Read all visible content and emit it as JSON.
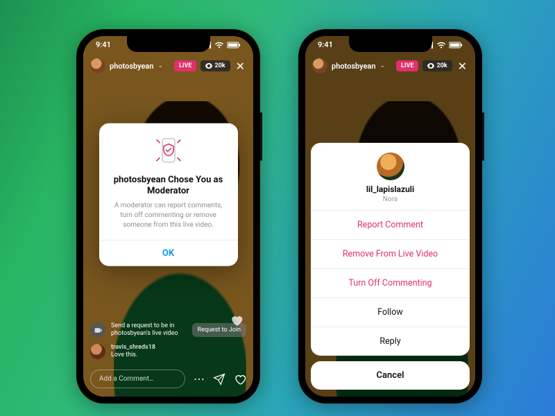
{
  "status": {
    "time": "9:41"
  },
  "live": {
    "username": "photosbyean",
    "live_badge": "LIVE",
    "viewer_count": "20k"
  },
  "modal": {
    "title": "photosbyean Chose You as Moderator",
    "body": "A moderator can report comments, turn off commenting or remove someone from this live video.",
    "ok": "OK"
  },
  "comments": {
    "request_line1": "Send a request to be in",
    "request_line2": "photosbyean's live video",
    "request_button": "Request to Join",
    "c1_user": "travis_shreds18",
    "c1_text": "Love this."
  },
  "composer": {
    "placeholder": "Add a Comment…"
  },
  "sheet": {
    "username": "lil_lapislazuli",
    "display_name": "Nora",
    "report": "Report Comment",
    "remove": "Remove From Live Video",
    "turn_off": "Turn Off Commenting",
    "follow": "Follow",
    "reply": "Reply",
    "cancel": "Cancel"
  }
}
